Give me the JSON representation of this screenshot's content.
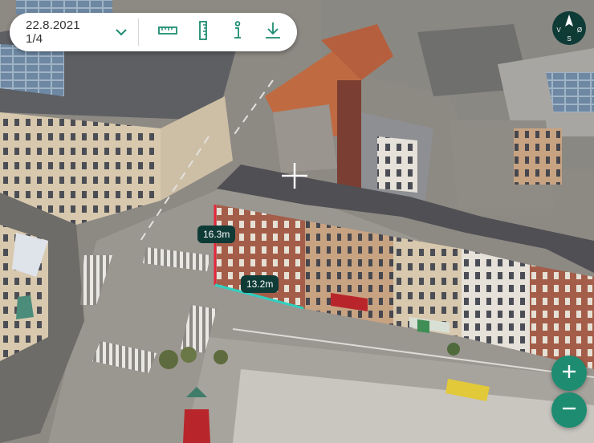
{
  "toolbar": {
    "date_selector": {
      "label": "22.8.2021 1/4",
      "icon": "chevron-down-icon"
    },
    "tools": [
      {
        "id": "measure-distance",
        "icon": "ruler-horizontal-icon"
      },
      {
        "id": "measure-height",
        "icon": "ruler-vertical-icon"
      },
      {
        "id": "info",
        "icon": "info-icon"
      },
      {
        "id": "download",
        "icon": "download-icon"
      }
    ]
  },
  "compass": {
    "n": "N",
    "w": "V",
    "s": "S",
    "e": "Ø"
  },
  "measurements": {
    "height": {
      "value": "16.3m",
      "color": "#e8263a"
    },
    "width": {
      "value": "13.2m",
      "color": "#2fd0c0"
    }
  },
  "zoom": {
    "in_label": "+",
    "out_label": "−"
  },
  "colors": {
    "accent": "#1d8c71",
    "label_bg": "#0f3b37",
    "toolbar_bg": "#ffffff"
  }
}
